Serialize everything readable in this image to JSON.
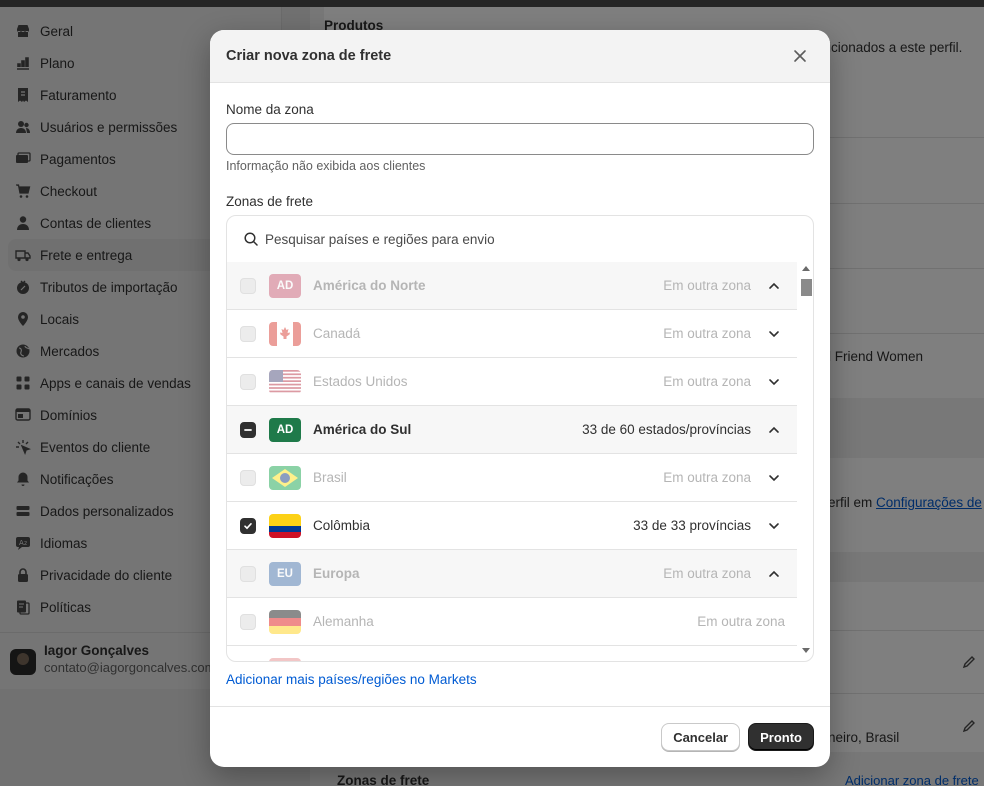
{
  "sidebar": {
    "items": [
      {
        "label": "Geral",
        "icon": "store-icon"
      },
      {
        "label": "Plano",
        "icon": "chart-icon"
      },
      {
        "label": "Faturamento",
        "icon": "receipt-icon"
      },
      {
        "label": "Usuários e permissões",
        "icon": "users-icon"
      },
      {
        "label": "Pagamentos",
        "icon": "cash-icon"
      },
      {
        "label": "Checkout",
        "icon": "cart-icon"
      },
      {
        "label": "Contas de clientes",
        "icon": "person-icon"
      },
      {
        "label": "Frete e entrega",
        "icon": "truck-icon",
        "active": true
      },
      {
        "label": "Tributos de importação",
        "icon": "tax-icon"
      },
      {
        "label": "Locais",
        "icon": "location-icon"
      },
      {
        "label": "Mercados",
        "icon": "globe-icon"
      },
      {
        "label": "Apps e canais de vendas",
        "icon": "apps-icon"
      },
      {
        "label": "Domínios",
        "icon": "domain-icon"
      },
      {
        "label": "Eventos do cliente",
        "icon": "cursor-icon"
      },
      {
        "label": "Notificações",
        "icon": "bell-icon"
      },
      {
        "label": "Dados personalizados",
        "icon": "database-icon"
      },
      {
        "label": "Idiomas",
        "icon": "language-icon"
      },
      {
        "label": "Privacidade do cliente",
        "icon": "lock-icon"
      },
      {
        "label": "Políticas",
        "icon": "policy-icon"
      }
    ],
    "user": {
      "name": "Iagor Gonçalves",
      "email": "contato@iagorgoncalves.com"
    }
  },
  "background": {
    "products_title": "Produtos",
    "profile_text": "icionados a este perfil.",
    "friend_text": "l Friend Women",
    "config_prefix": "erfil em ",
    "config_link": "Configurações de",
    "address_text": "neiro, Brasil",
    "zones_title": "Zonas de frete",
    "add_zone_link": "Adicionar zona de frete"
  },
  "modal": {
    "title": "Criar nova zona de frete",
    "zone_name_label": "Nome da zona",
    "zone_name_value": "",
    "zone_name_help": "Informação não exibida aos clientes",
    "zones_label": "Zonas de frete",
    "search_placeholder": "Pesquisar países e regiões para envio",
    "rows": [
      {
        "name": "América do Norte",
        "status": "Em outra zona",
        "badge": "AD",
        "group": true,
        "dim": true,
        "checked": "none",
        "chevron": "up",
        "flag_color": "#c8506a"
      },
      {
        "name": "Canadá",
        "status": "Em outra zona",
        "flag": "canada",
        "group": false,
        "dim": true,
        "checked": "none",
        "chevron": "down"
      },
      {
        "name": "Estados Unidos",
        "status": "Em outra zona",
        "flag": "usa",
        "group": false,
        "dim": true,
        "checked": "none",
        "chevron": "down"
      },
      {
        "name": "América do Sul",
        "status": "33 de 60 estados/províncias",
        "badge": "AD",
        "group": true,
        "dim": false,
        "checked": "partial",
        "chevron": "up",
        "flag_color": "#1f7a4a"
      },
      {
        "name": "Brasil",
        "status": "Em outra zona",
        "flag": "brazil",
        "group": false,
        "dim": true,
        "checked": "none",
        "chevron": "down"
      },
      {
        "name": "Colômbia",
        "status": "33 de 33 províncias",
        "flag": "colombia",
        "group": false,
        "dim": false,
        "checked": "full",
        "chevron": "down"
      },
      {
        "name": "Europa",
        "status": "Em outra zona",
        "badge": "EU",
        "group": true,
        "dim": true,
        "checked": "none",
        "chevron": "up",
        "flag_color": "#3a6aa8"
      },
      {
        "name": "Alemanha",
        "status": "Em outra zona",
        "flag": "germany",
        "group": false,
        "dim": true,
        "checked": "none",
        "chevron": "none"
      }
    ],
    "add_link": "Adicionar mais países/regiões no Markets",
    "cancel_label": "Cancelar",
    "done_label": "Pronto"
  }
}
